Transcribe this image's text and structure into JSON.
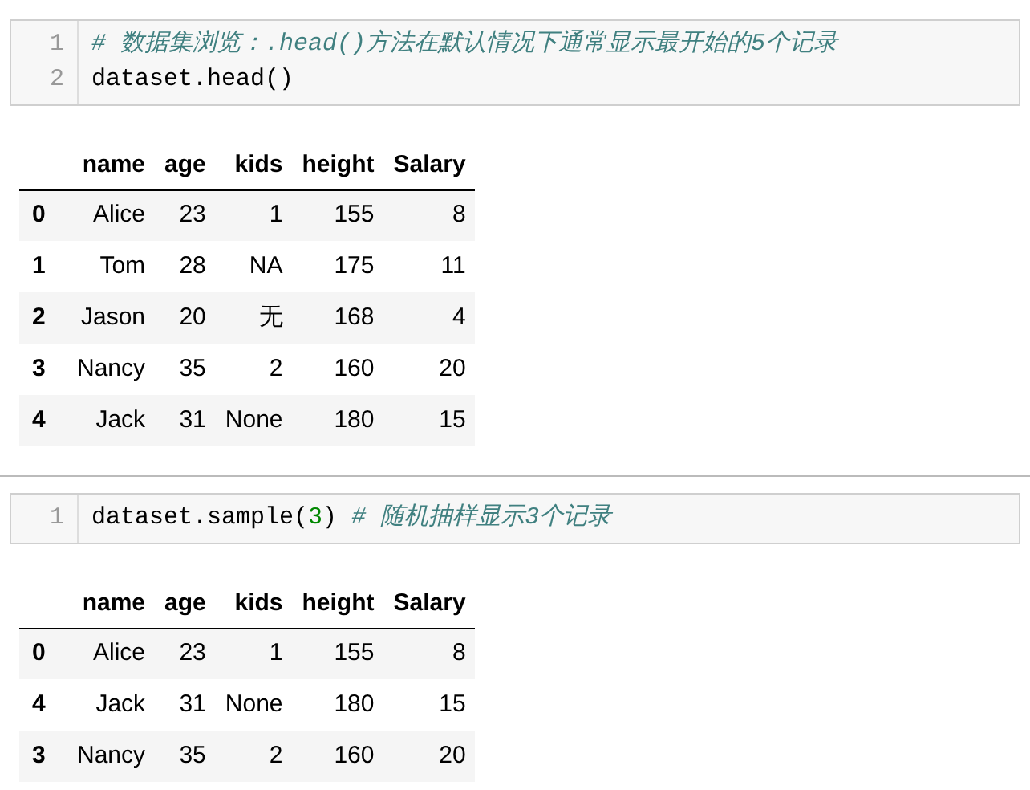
{
  "cells": [
    {
      "code": {
        "lines": [
          {
            "number": "1",
            "tokens": [
              {
                "kind": "comment",
                "text": "# 数据集浏览：.head()方法在默认情况下通常显示最开始的5个记录"
              }
            ]
          },
          {
            "number": "2",
            "tokens": [
              {
                "kind": "plain",
                "text": "dataset.head()"
              }
            ]
          }
        ]
      },
      "output": {
        "columns": [
          "name",
          "age",
          "kids",
          "height",
          "Salary"
        ],
        "rows": [
          {
            "index": "0",
            "cells": [
              "Alice",
              "23",
              "1",
              "155",
              "8"
            ]
          },
          {
            "index": "1",
            "cells": [
              "Tom",
              "28",
              "NA",
              "175",
              "11"
            ]
          },
          {
            "index": "2",
            "cells": [
              "Jason",
              "20",
              "无",
              "168",
              "4"
            ]
          },
          {
            "index": "3",
            "cells": [
              "Nancy",
              "35",
              "2",
              "160",
              "20"
            ]
          },
          {
            "index": "4",
            "cells": [
              "Jack",
              "31",
              "None",
              "180",
              "15"
            ]
          }
        ]
      }
    },
    {
      "code": {
        "lines": [
          {
            "number": "1",
            "tokens": [
              {
                "kind": "plain",
                "text": "dataset.sample("
              },
              {
                "kind": "number",
                "text": "3"
              },
              {
                "kind": "plain",
                "text": ") "
              },
              {
                "kind": "comment",
                "text": "# 随机抽样显示3个记录"
              }
            ]
          }
        ]
      },
      "output": {
        "columns": [
          "name",
          "age",
          "kids",
          "height",
          "Salary"
        ],
        "rows": [
          {
            "index": "0",
            "cells": [
              "Alice",
              "23",
              "1",
              "155",
              "8"
            ]
          },
          {
            "index": "4",
            "cells": [
              "Jack",
              "31",
              "None",
              "180",
              "15"
            ]
          },
          {
            "index": "3",
            "cells": [
              "Nancy",
              "35",
              "2",
              "160",
              "20"
            ]
          }
        ]
      }
    }
  ]
}
